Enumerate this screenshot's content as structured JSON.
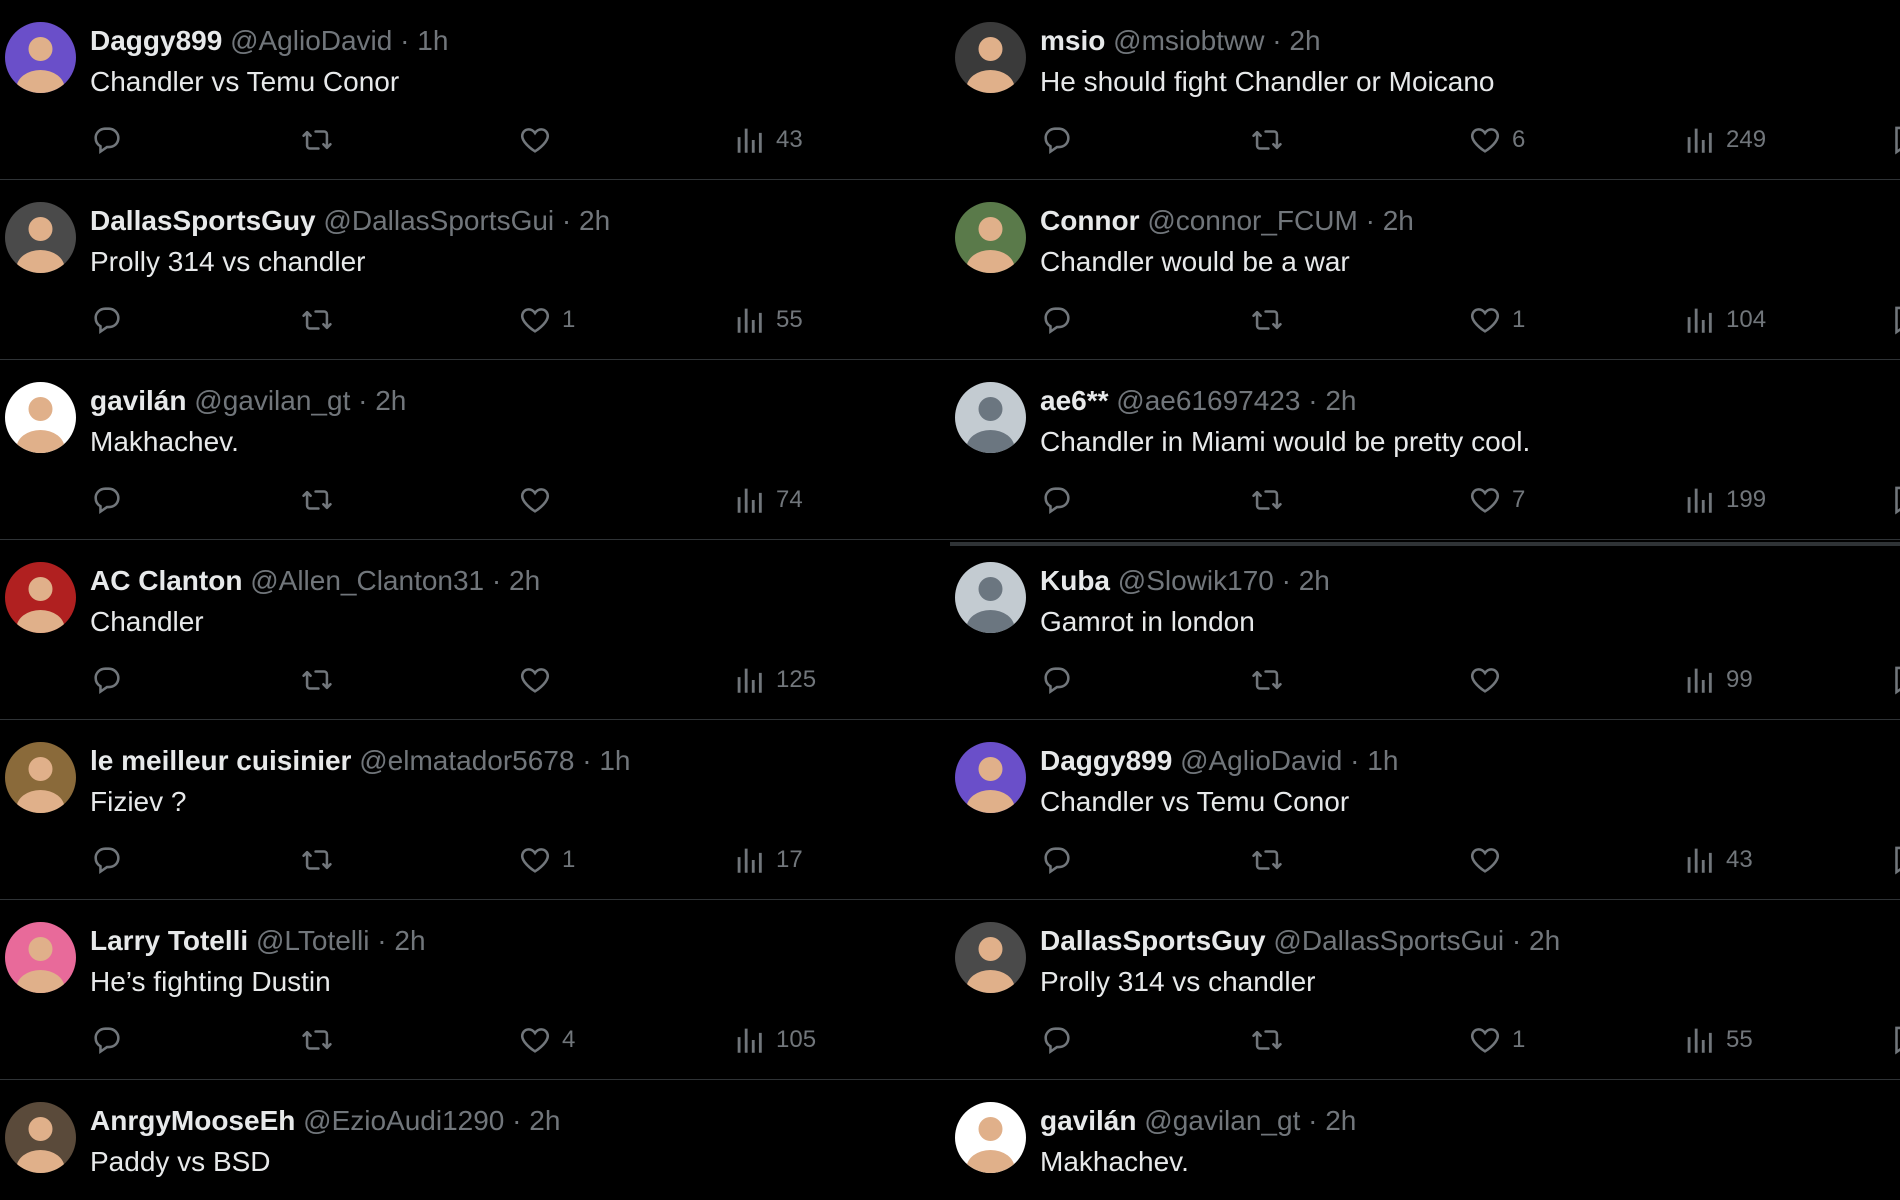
{
  "colors": {
    "background": "#000000",
    "text": "#e7e9ea",
    "muted": "#71767b",
    "divider": "#2f3336"
  },
  "icons": {
    "reply": "reply-icon",
    "retweet": "retweet-icon",
    "like": "heart-icon",
    "views": "views-bar-chart-icon",
    "bookmark": "bookmark-icon"
  },
  "left_column": [
    {
      "name": "Daggy899",
      "handle": "@AglioDavid",
      "time": "1h",
      "text": "Chandler vs Temu Conor",
      "likes": "",
      "views": "43",
      "avatar_color": "#6a4fc9"
    },
    {
      "name": "DallasSportsGuy",
      "handle": "@DallasSportsGui",
      "time": "2h",
      "text": "Prolly 314 vs chandler",
      "likes": "1",
      "views": "55",
      "avatar_color": "#4a4a4a"
    },
    {
      "name": "gavilán",
      "handle": "@gavilan_gt",
      "time": "2h",
      "text": "Makhachev.",
      "likes": "",
      "views": "74",
      "avatar_color": "#ffffff"
    },
    {
      "name": "AC Clanton",
      "handle": "@Allen_Clanton31",
      "time": "2h",
      "text": "Chandler",
      "likes": "",
      "views": "125",
      "avatar_color": "#b02020"
    },
    {
      "name": "le meilleur cuisinier",
      "handle": "@elmatador5678",
      "time": "1h",
      "text": "Fiziev ?",
      "likes": "1",
      "views": "17",
      "avatar_color": "#8a6a3a"
    },
    {
      "name": "Larry Totelli",
      "handle": "@LTotelli",
      "time": "2h",
      "text": "He’s fighting Dustin",
      "likes": "4",
      "views": "105",
      "avatar_color": "#e86a9a"
    },
    {
      "name": "AnrgyMooseEh",
      "handle": "@EzioAudi1290",
      "time": "2h",
      "text": "Paddy vs BSD",
      "likes": "",
      "views": "",
      "avatar_color": "#5a4a3a"
    }
  ],
  "right_column": [
    {
      "name": "msio",
      "handle": "@msiobtww",
      "time": "2h",
      "text": "He should fight Chandler or Moicano",
      "likes": "6",
      "views": "249",
      "avatar_color": "#3a3a3a"
    },
    {
      "name": "Connor",
      "handle": "@connor_FCUM",
      "time": "2h",
      "text": "Chandler would be a war",
      "likes": "1",
      "views": "104",
      "avatar_color": "#5a7a4a"
    },
    {
      "name": "ae6**",
      "handle": "@ae61697423",
      "time": "2h",
      "text": "Chandler in Miami would be pretty cool.",
      "likes": "7",
      "views": "199",
      "avatar_color": "#c3cbd1"
    },
    {
      "name": "Kuba",
      "handle": "@Slowik170",
      "time": "2h",
      "text": "Gamrot in london",
      "likes": "",
      "views": "99",
      "avatar_color": "#c3cbd1"
    },
    {
      "name": "Daggy899",
      "handle": "@AglioDavid",
      "time": "1h",
      "text": "Chandler vs Temu Conor",
      "likes": "",
      "views": "43",
      "avatar_color": "#6a4fc9"
    },
    {
      "name": "DallasSportsGuy",
      "handle": "@DallasSportsGui",
      "time": "2h",
      "text": "Prolly 314 vs chandler",
      "likes": "1",
      "views": "55",
      "avatar_color": "#4a4a4a"
    },
    {
      "name": "gavilán",
      "handle": "@gavilan_gt",
      "time": "2h",
      "text": "Makhachev.",
      "likes": "",
      "views": "",
      "avatar_color": "#ffffff"
    }
  ]
}
